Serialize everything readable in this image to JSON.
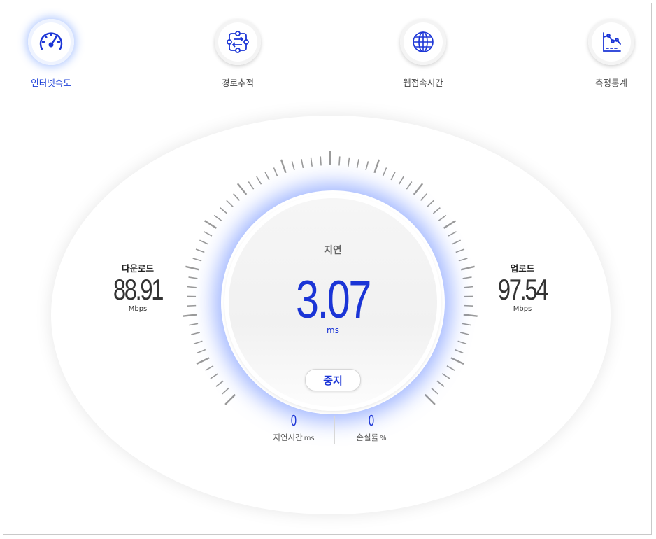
{
  "nav": {
    "items": [
      {
        "label": "인터넷속도",
        "icon": "speedometer-icon",
        "active": true
      },
      {
        "label": "경로추적",
        "icon": "route-trace-icon",
        "active": false
      },
      {
        "label": "웹접속시간",
        "icon": "globe-icon",
        "active": false
      },
      {
        "label": "측정통계",
        "icon": "statistics-chart-icon",
        "active": false
      }
    ]
  },
  "gauge": {
    "center_label": "지연",
    "latency_value": "3.07",
    "latency_unit": "ms",
    "stop_label": "중지"
  },
  "download": {
    "label": "다운로드",
    "value": "88.91",
    "unit": "Mbps"
  },
  "upload": {
    "label": "업로드",
    "value": "97.54",
    "unit": "Mbps"
  },
  "stats": {
    "latency_time": {
      "value": "0",
      "label": "지연시간",
      "unit": "ms"
    },
    "loss_rate": {
      "value": "0",
      "label": "손실률",
      "unit": "%"
    }
  },
  "colors": {
    "accent": "#1b35d6",
    "glow": "#5a8cff",
    "tick": "#9a9a9a"
  }
}
